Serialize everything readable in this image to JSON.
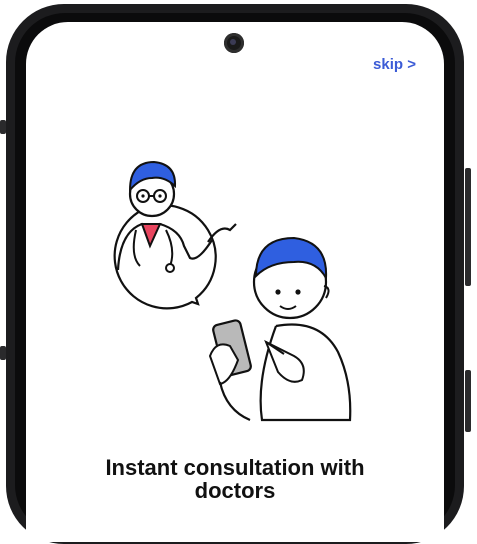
{
  "onboarding": {
    "skip_label": "skip >",
    "title_line1": "Instant consultation with",
    "title_line2": "doctors"
  },
  "colors": {
    "accent": "#3b5bd6",
    "hair": "#2f5fe0",
    "shirt": "#e8455f",
    "frame": "#1c1c1e"
  },
  "illustration": {
    "icon": "doctor-and-patient-illustration"
  }
}
